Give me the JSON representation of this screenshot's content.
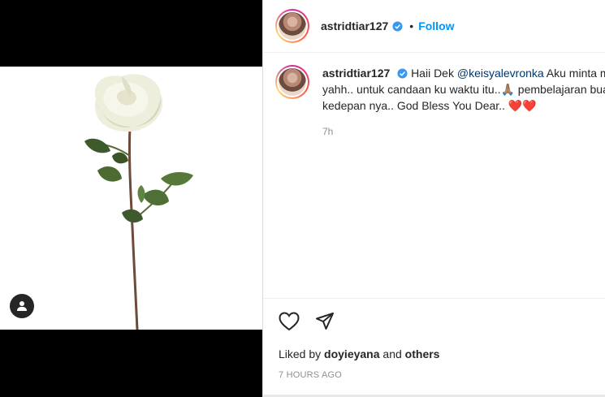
{
  "post": {
    "username": "astridtiar127",
    "follow_label": "Follow",
    "separator": "•"
  },
  "caption": {
    "username": "astridtiar127",
    "text_before_mention": "Haii Dek ",
    "mention": "@keisyalevronka",
    "text_line1_after": " Aku minta maaf",
    "line2": "yahh.. untuk candaan ku waktu itu..🙏🏽 pembelajaran buat",
    "line3": "kedepan nya.. God Bless You Dear.. ❤️❤️",
    "time": "7h"
  },
  "likes": {
    "prefix": "Liked by ",
    "user": "doyieyana",
    "middle": " and ",
    "others": "others"
  },
  "timestamp": "7 HOURS AGO",
  "icons": {
    "like": "heart-icon",
    "share": "paper-plane-icon",
    "tag": "user-tag-icon",
    "verified": "verified-badge-icon"
  },
  "colors": {
    "follow": "#0095f6",
    "verified": "#3897f0",
    "mention": "#00376b",
    "secondary_text": "#8e8e8e"
  }
}
